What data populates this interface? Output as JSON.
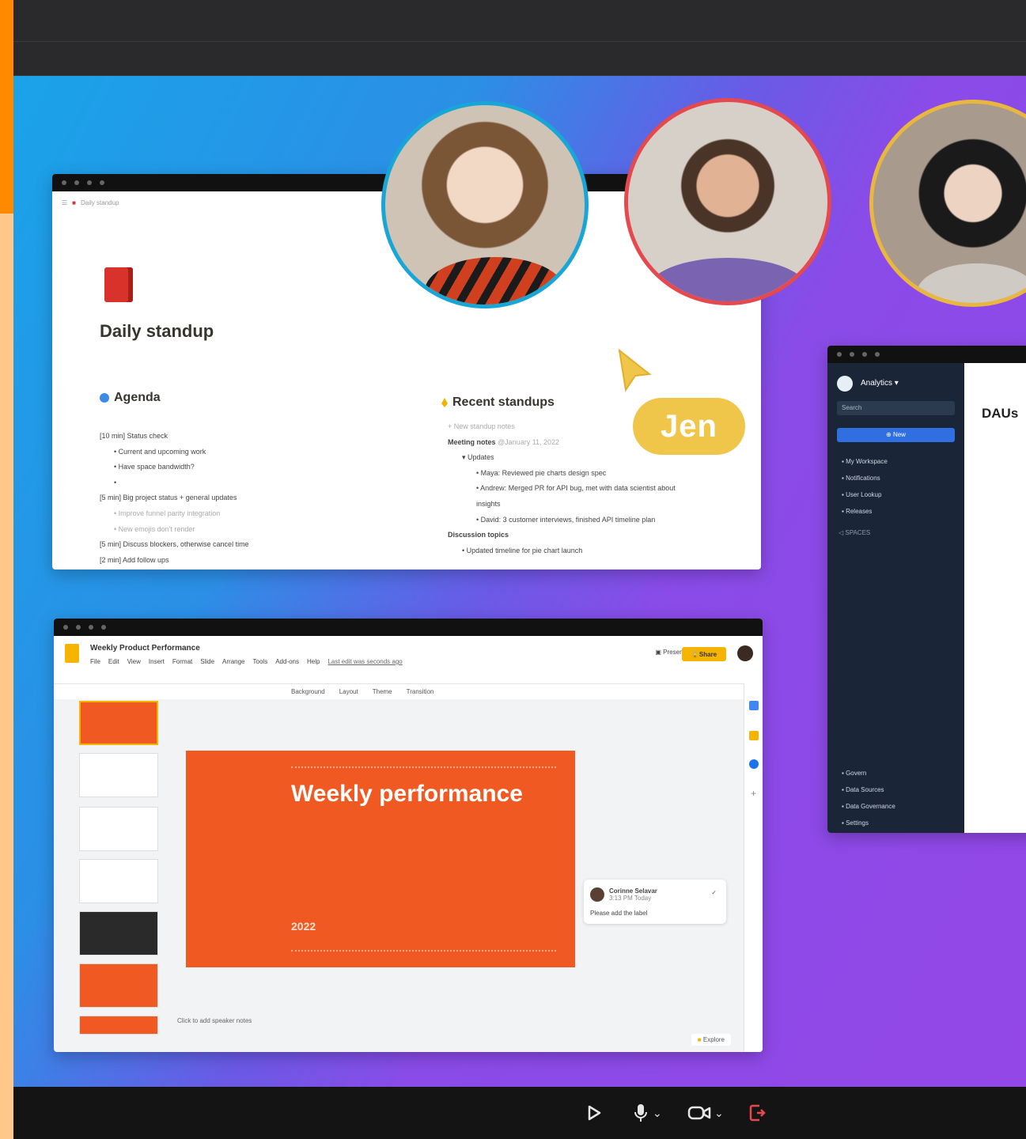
{
  "stage": {
    "cursor_label": "Jen",
    "participants": [
      {
        "name": "participant-1",
        "ring_color": "#18a6d6"
      },
      {
        "name": "participant-2",
        "ring_color": "#e5484d"
      },
      {
        "name": "participant-3",
        "ring_color": "#e9b73d"
      }
    ]
  },
  "notion": {
    "breadcrumb": "Daily standup",
    "title": "Daily standup",
    "agenda_heading": "Agenda",
    "agenda_lines": [
      {
        "text": "[10 min] Status check",
        "level": 0,
        "bold": false
      },
      {
        "text": "Current and upcoming work",
        "level": 1
      },
      {
        "text": "Have space bandwidth?",
        "level": 1
      },
      {
        "text": "",
        "level": 1
      },
      {
        "text": "[5 min] Big project status + general updates",
        "level": 0
      },
      {
        "text": "Improve funnel parity integration",
        "level": 1,
        "muted": true
      },
      {
        "text": "New emojis don't render",
        "level": 1,
        "muted": true
      },
      {
        "text": "[5 min] Discuss blockers, otherwise cancel time",
        "level": 0
      },
      {
        "text": "[2 min] Add follow ups",
        "level": 0
      }
    ],
    "recent_heading": "Recent standups",
    "recent_placeholder": "New standup notes",
    "meeting_notes_label": "Meeting notes",
    "meeting_notes_date": "January 11, 2022",
    "recent_lines": [
      {
        "text": "Updates",
        "level": 1
      },
      {
        "text": "Maya: Reviewed pie charts design spec",
        "level": 2
      },
      {
        "text": "Andrew: Merged PR for API bug, met with data scientist about",
        "level": 2
      },
      {
        "text": "insights",
        "level": 2
      },
      {
        "text": "David: 3 customer interviews, finished API timeline plan",
        "level": 2
      }
    ],
    "discussion_heading": "Discussion topics",
    "discussion_first": "Updated timeline for pie chart launch"
  },
  "slides": {
    "doc_name": "Weekly Product Performance",
    "menu": [
      "File",
      "Edit",
      "View",
      "Insert",
      "Format",
      "Slide",
      "Arrange",
      "Tools",
      "Add-ons",
      "Help",
      "Last edit was seconds ago"
    ],
    "present_label": "Present",
    "share_label": "Share",
    "toolbar": [
      "Background",
      "Layout",
      "Theme",
      "Transition"
    ],
    "slide_title": "Weekly performance",
    "slide_year": "2022",
    "comment_author": "Corinne Selavar",
    "comment_time": "3:13 PM Today",
    "comment_text": "Please add the label",
    "speaker_notes": "Click to add speaker notes",
    "explore_label": "Explore"
  },
  "analytics": {
    "app_name": "Analytics",
    "search_placeholder": "Search",
    "new_button": "New",
    "nav": [
      "My Workspace",
      "Notifications",
      "User Lookup",
      "Releases"
    ],
    "spaces_label": "SPACES",
    "nav_bottom": [
      "Govern",
      "Data Sources",
      "Data Governance",
      "Settings"
    ],
    "page_title": "DAUs"
  },
  "controls": {
    "share_icon": "play-icon",
    "mic_icon": "microphone-icon",
    "camera_icon": "camera-icon",
    "leave_icon": "leave-icon",
    "leave_color": "#e5484d"
  }
}
